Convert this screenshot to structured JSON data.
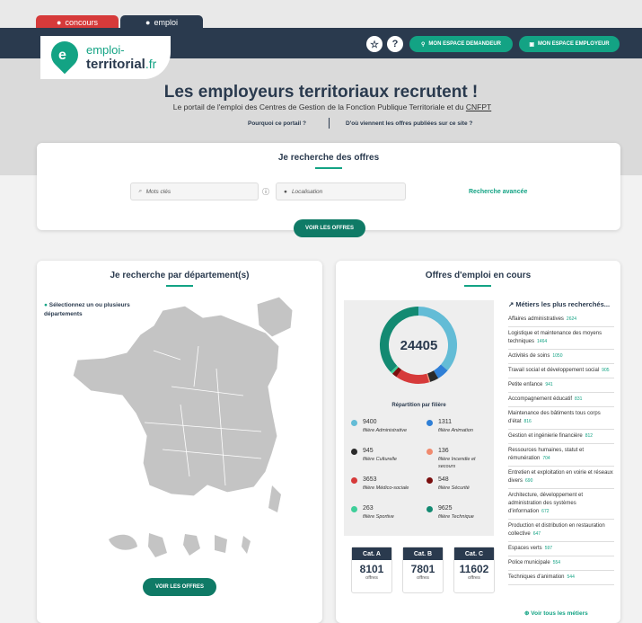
{
  "tabs": [
    {
      "label": "concours"
    },
    {
      "label": "emploi"
    }
  ],
  "header": {
    "favorite_icon": "star-icon",
    "help_label": "?",
    "candidate_button": "MON ESPACE DEMANDEUR",
    "employer_button": "MON ESPACE EMPLOYEUR"
  },
  "logo": {
    "line1": "emploi-",
    "line2": "territorial",
    "suffix": ".fr"
  },
  "hero": {
    "title": "Les employeurs territoriaux recrutent !",
    "subtitle": "Le portail de l'emploi des Centres de Gestion de la Fonction Publique Territoriale et du",
    "subtitle_link": "CNFPT",
    "link1": "Pourquoi ce portail ?",
    "link2": "D'où viennent les offres publiées sur ce site ?"
  },
  "search": {
    "title": "Je recherche des offres",
    "keywords_placeholder": "Mots clés",
    "location_placeholder": "Localisation",
    "advanced_link": "Recherche avancée",
    "submit": "VOIR LES OFFRES"
  },
  "departments": {
    "title": "Je recherche par département(s)",
    "hint": "Sélectionnez un ou plusieurs départements",
    "submit": "VOIR LES OFFRES"
  },
  "offers": {
    "title": "Offres d'emploi en cours",
    "total": "24405",
    "repartition_label": "Répartition par filière",
    "filieres": [
      {
        "value": "9400",
        "label": "filière Administrative",
        "color": "#63bcd6"
      },
      {
        "value": "1311",
        "label": "filière Animation",
        "color": "#2f7fd6"
      },
      {
        "value": "945",
        "label": "filière Culturelle",
        "color": "#2a2a2a"
      },
      {
        "value": "136",
        "label": "filière Incendie et secours",
        "color": "#f08a6e"
      },
      {
        "value": "3653",
        "label": "filière Médico-sociale",
        "color": "#d63a3a"
      },
      {
        "value": "548",
        "label": "filière Sécurité",
        "color": "#7a0e0e"
      },
      {
        "value": "263",
        "label": "filière Sportive",
        "color": "#3fcf9a"
      },
      {
        "value": "9625",
        "label": "filière Technique",
        "color": "#138a72"
      }
    ],
    "categories": [
      {
        "label": "Cat. A",
        "value": "8101",
        "unit": "offres"
      },
      {
        "label": "Cat. B",
        "value": "7801",
        "unit": "offres"
      },
      {
        "label": "Cat. C",
        "value": "11602",
        "unit": "offres"
      }
    ],
    "metiers_title": "Métiers les plus recherchés...",
    "metiers": [
      {
        "label": "Affaires administratives",
        "count": "2624"
      },
      {
        "label": "Logistique et maintenance des moyens techniques",
        "count": "1464"
      },
      {
        "label": "Activités de soins",
        "count": "1050"
      },
      {
        "label": "Travail social et développement social",
        "count": "905"
      },
      {
        "label": "Petite enfance",
        "count": "941"
      },
      {
        "label": "Accompagnement éducatif",
        "count": "831"
      },
      {
        "label": "Maintenance des bâtiments tous corps d'état",
        "count": "816"
      },
      {
        "label": "Gestion et ingénierie financière",
        "count": "812"
      },
      {
        "label": "Ressources humaines, statut et rémunération",
        "count": "704"
      },
      {
        "label": "Entretien et exploitation en voirie et réseaux divers",
        "count": "690"
      },
      {
        "label": "Architecture, développement et administration des systèmes d'information",
        "count": "672"
      },
      {
        "label": "Production et distribution en restauration collective",
        "count": "647"
      },
      {
        "label": "Espaces verts",
        "count": "597"
      },
      {
        "label": "Police municipale",
        "count": "554"
      },
      {
        "label": "Techniques d'animation",
        "count": "544"
      }
    ],
    "all_link": "Voir tous les métiers"
  }
}
